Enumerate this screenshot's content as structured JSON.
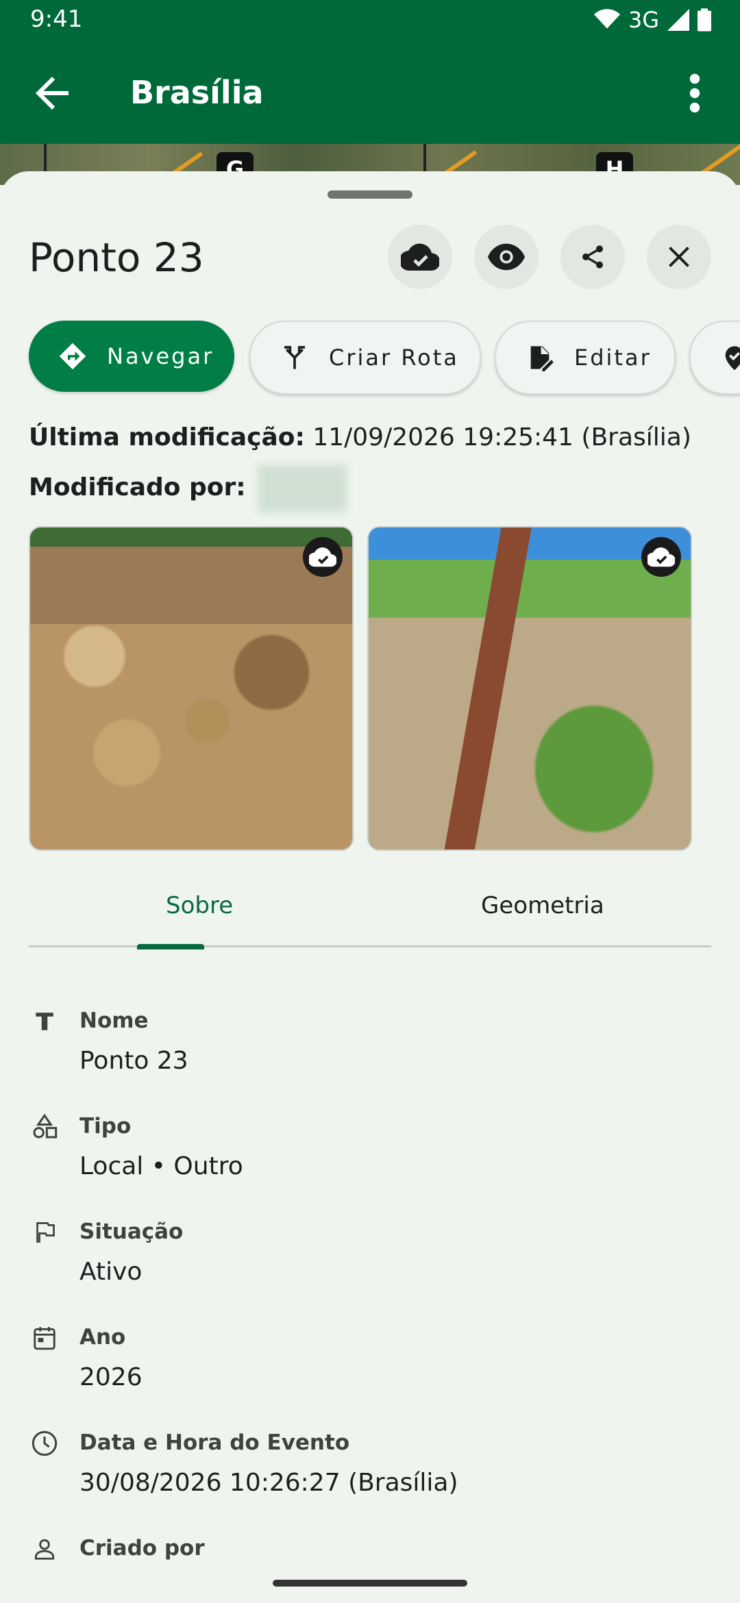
{
  "status_bar": {
    "time": "9:41",
    "network": "3G"
  },
  "app_bar": {
    "title": "Brasília"
  },
  "map": {
    "markers": [
      "G",
      "H"
    ]
  },
  "sheet": {
    "title": "Ponto 23",
    "actions": {
      "primary": "Navegar",
      "route": "Criar Rota",
      "edit": "Editar"
    },
    "last_modified_label": "Última modificação:",
    "last_modified_value": "11/09/2026 19:25:41 (Brasília)",
    "modified_by_label": "Modificado por:"
  },
  "tabs": {
    "about": "Sobre",
    "geometry": "Geometria"
  },
  "fields": [
    {
      "label": "Nome",
      "value": "Ponto 23",
      "icon": "text-icon"
    },
    {
      "label": "Tipo",
      "value": "Local • Outro",
      "icon": "shapes-icon"
    },
    {
      "label": "Situação",
      "value": "Ativo",
      "icon": "flag-icon"
    },
    {
      "label": "Ano",
      "value": "2026",
      "icon": "calendar-icon"
    },
    {
      "label": "Data e Hora do Evento",
      "value": "30/08/2026 10:26:27 (Brasília)",
      "icon": "clock-icon"
    },
    {
      "label": "Criado por",
      "value": "",
      "icon": "person-icon"
    }
  ],
  "colors": {
    "primary": "#007e46",
    "app_bar": "#00693a",
    "accent": "#0a6a3f"
  }
}
